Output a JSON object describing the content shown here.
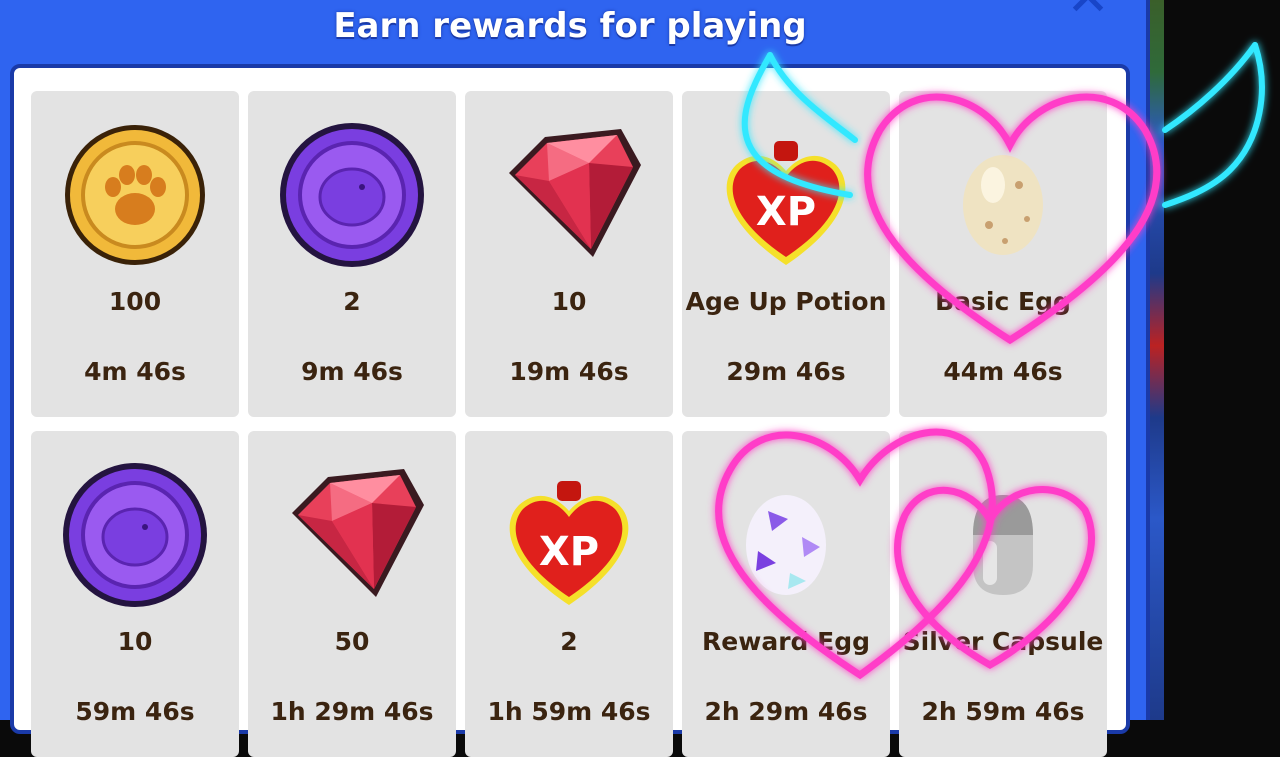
{
  "window": {
    "title": "Earn rewards for playing",
    "close_label": "✕"
  },
  "rewards": [
    {
      "label": "100",
      "time": "4m 46s",
      "icon": "paw-coin-icon"
    },
    {
      "label": "2",
      "time": "9m 46s",
      "icon": "purple-chick-coin-icon"
    },
    {
      "label": "10",
      "time": "19m 46s",
      "icon": "ruby-gem-icon"
    },
    {
      "label": "Age Up Potion",
      "time": "29m 46s",
      "icon": "xp-potion-icon"
    },
    {
      "label": "Basic Egg",
      "time": "44m 46s",
      "icon": "basic-egg-icon"
    },
    {
      "label": "10",
      "time": "59m 46s",
      "icon": "purple-chick-coin-icon"
    },
    {
      "label": "50",
      "time": "1h 29m 46s",
      "icon": "ruby-gem-icon"
    },
    {
      "label": "2",
      "time": "1h 59m 46s",
      "icon": "xp-potion-icon"
    },
    {
      "label": "Reward Egg",
      "time": "2h 29m 46s",
      "icon": "reward-egg-icon"
    },
    {
      "label": "Silver Capsule",
      "time": "2h 59m 46s",
      "icon": "silver-capsule-icon"
    }
  ],
  "colors": {
    "panel_blue": "#2f64f0",
    "card_grey": "#e3e3e3",
    "text_brown": "#3b2410",
    "neon_pink": "#ff3ec8",
    "neon_cyan": "#33e8ff"
  }
}
